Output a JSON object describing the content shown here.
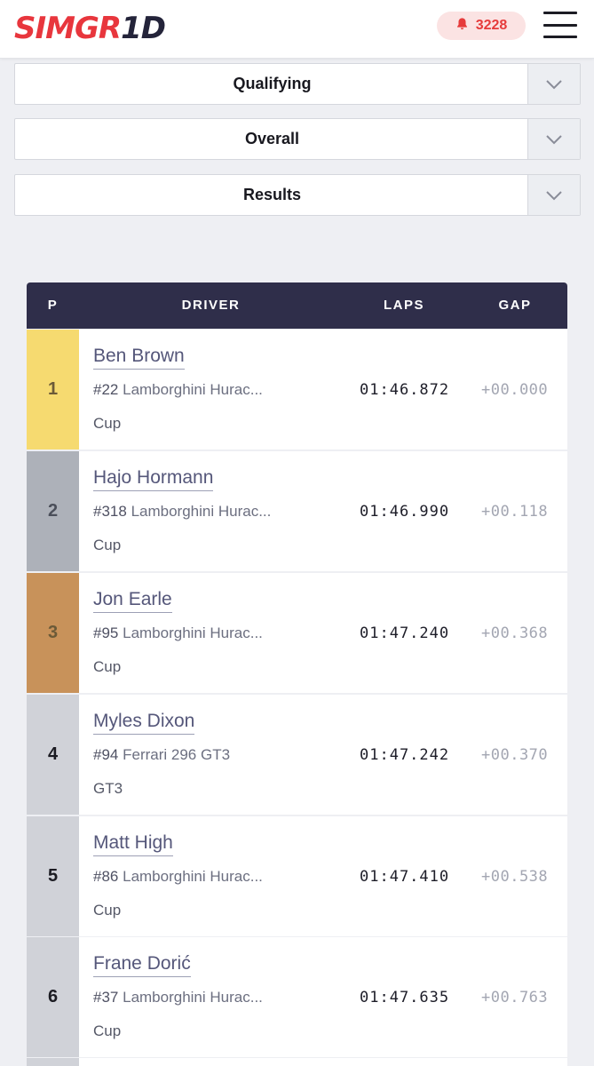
{
  "header": {
    "logo_part1": "SIMGR",
    "logo_part2": "1",
    "logo_part3": "D",
    "notification_count": "3228",
    "bell_icon": "bell-icon",
    "menu_icon": "hamburger-menu-icon"
  },
  "filters": [
    {
      "label": "Qualifying"
    },
    {
      "label": "Overall"
    },
    {
      "label": "Results"
    }
  ],
  "table": {
    "columns": [
      "P",
      "DRIVER",
      "LAPS",
      "GAP"
    ],
    "rows": [
      {
        "pos": "1",
        "driver": "Ben Brown",
        "car_number": "#22",
        "car": "Lamborghini Hurac...",
        "class": "Cup",
        "lap": "01:46.872",
        "gap": "+00.000",
        "pos_color": "#f6da70"
      },
      {
        "pos": "2",
        "driver": "Hajo Hormann",
        "car_number": "#318",
        "car": "Lamborghini Hurac...",
        "class": "Cup",
        "lap": "01:46.990",
        "gap": "+00.118",
        "pos_color": "#adb1b9"
      },
      {
        "pos": "3",
        "driver": "Jon Earle",
        "car_number": "#95",
        "car": "Lamborghini Hurac...",
        "class": "Cup",
        "lap": "01:47.240",
        "gap": "+00.368",
        "pos_color": "#c8925a"
      },
      {
        "pos": "4",
        "driver": "Myles Dixon",
        "car_number": "#94",
        "car": "Ferrari 296 GT3",
        "class": "GT3",
        "lap": "01:47.242",
        "gap": "+00.370",
        "pos_color": "#d0d2d8"
      },
      {
        "pos": "5",
        "driver": "Matt High",
        "car_number": "#86",
        "car": "Lamborghini Hurac...",
        "class": "Cup",
        "lap": "01:47.410",
        "gap": "+00.538",
        "pos_color": "#d0d2d8"
      },
      {
        "pos": "6",
        "driver": "Frane Dorić",
        "car_number": "#37",
        "car": "Lamborghini Hurac...",
        "class": "Cup",
        "lap": "01:47.635",
        "gap": "+00.763",
        "pos_color": "#d0d2d8"
      }
    ]
  },
  "colors": {
    "brand_red": "#e8363d",
    "brand_dark": "#24243a",
    "table_header_bg": "#2f2e4a"
  }
}
